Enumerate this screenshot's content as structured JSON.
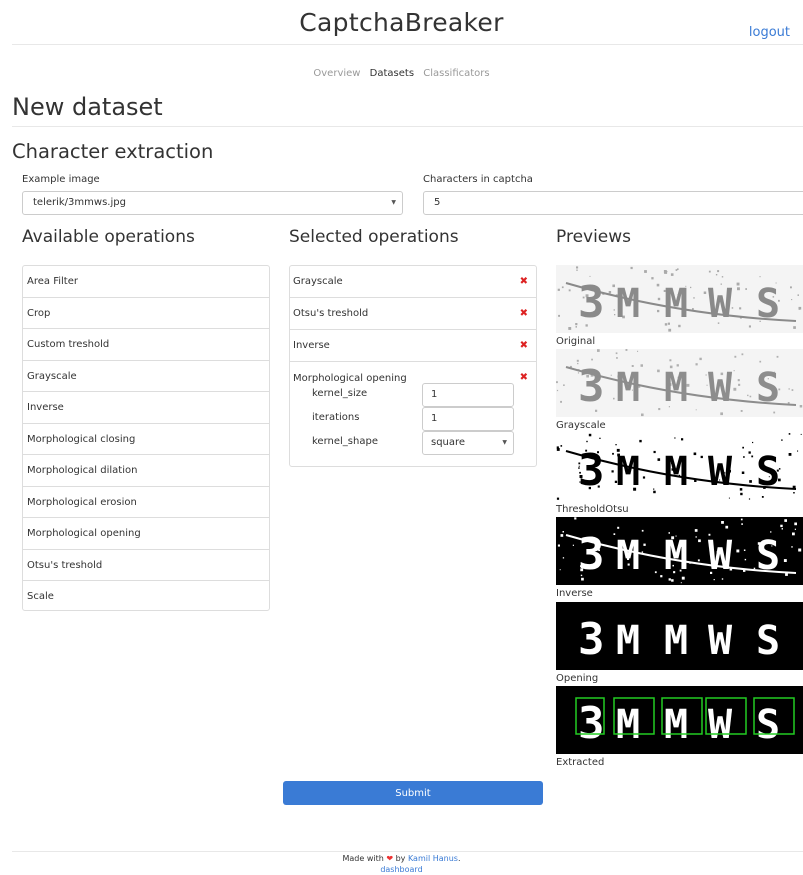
{
  "header": {
    "brand": "CaptchaBreaker",
    "logout": "logout"
  },
  "nav": {
    "items": [
      {
        "label": "Overview",
        "active": false
      },
      {
        "label": "Datasets",
        "active": true
      },
      {
        "label": "Classificators",
        "active": false
      }
    ]
  },
  "page_title": "New dataset",
  "section_title": "Character extraction",
  "form": {
    "example_image_label": "Example image",
    "example_image_value": "telerik/3mmws.jpg",
    "characters_label": "Characters in captcha",
    "characters_value": "5"
  },
  "available": {
    "title": "Available operations",
    "items": [
      "Area Filter",
      "Crop",
      "Custom treshold",
      "Grayscale",
      "Inverse",
      "Morphological closing",
      "Morphological dilation",
      "Morphological erosion",
      "Morphological opening",
      "Otsu's treshold",
      "Scale"
    ]
  },
  "selected": {
    "title": "Selected operations",
    "items": [
      "Grayscale",
      "Otsu's treshold",
      "Inverse",
      "Morphological opening"
    ],
    "remove_glyph": "✖",
    "params": {
      "kernel_size_label": "kernel_size",
      "kernel_size_value": "1",
      "iterations_label": "iterations",
      "iterations_value": "1",
      "kernel_shape_label": "kernel_shape",
      "kernel_shape_value": "square"
    }
  },
  "previews": {
    "title": "Previews",
    "captcha_text": "3MMWS",
    "items": [
      {
        "caption": "Original"
      },
      {
        "caption": "Grayscale"
      },
      {
        "caption": "ThresholdOtsu"
      },
      {
        "caption": "Inverse"
      },
      {
        "caption": "Opening"
      },
      {
        "caption": "Extracted"
      }
    ]
  },
  "submit_label": "Submit",
  "footer": {
    "made_with": "Made with",
    "heart": "❤",
    "by": "by",
    "author": "Kamil Hanus",
    "period": ".",
    "dashboard": "dashboard"
  },
  "colors": {
    "accent": "#3a7bd5",
    "remove": "#dd2222",
    "box": "#22cc22"
  }
}
